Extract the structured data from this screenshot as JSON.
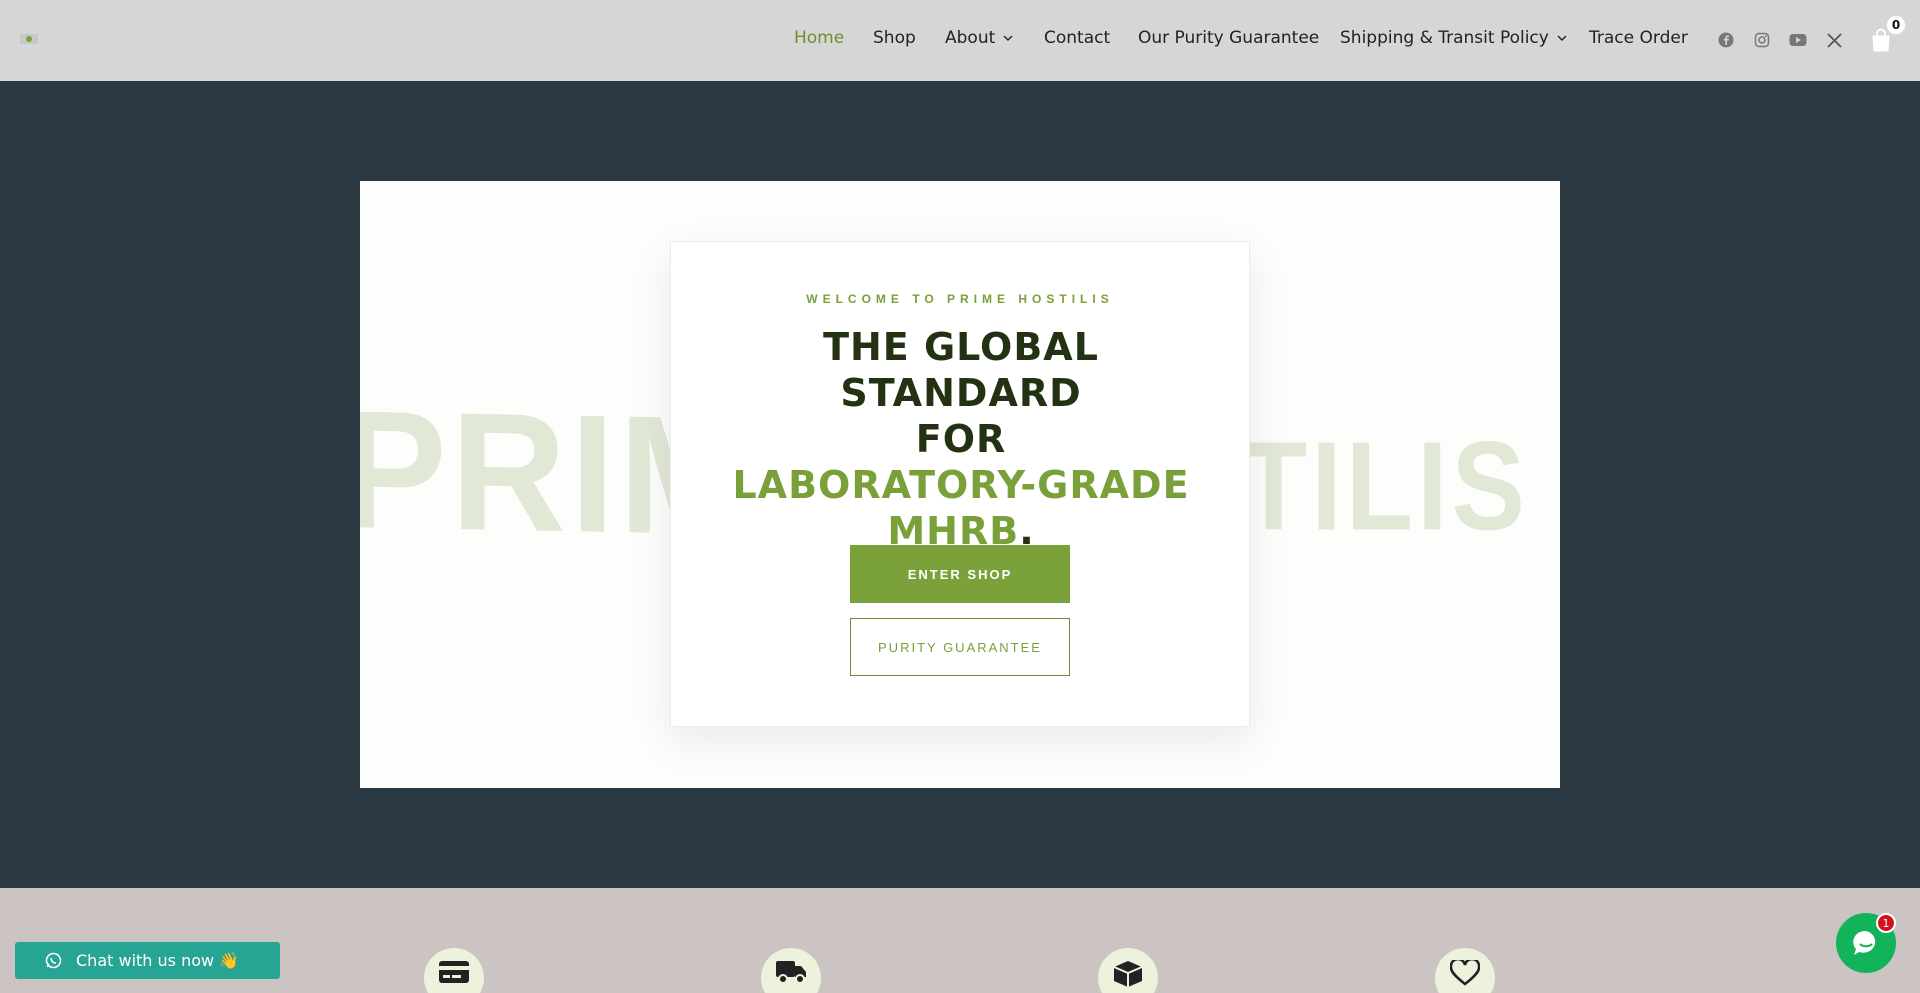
{
  "nav": {
    "items": [
      {
        "label": "Home",
        "active": true
      },
      {
        "label": "Shop"
      },
      {
        "label": "About",
        "dropdown": true
      },
      {
        "label": "Contact"
      },
      {
        "label": "Our Purity Guarantee"
      },
      {
        "label": "Shipping & Transit Policy",
        "dropdown": true
      },
      {
        "label": "Trace Order"
      }
    ],
    "social": [
      "facebook-icon",
      "instagram-icon",
      "youtube-icon",
      "x-icon"
    ],
    "cart_count": "0"
  },
  "hero": {
    "bg_left": "PRIM",
    "bg_right": "TILIS",
    "eyebrow": "WELCOME TO PRIME HOSTILIS",
    "headline_line1": "THE GLOBAL STANDARD",
    "headline_line2": "FOR",
    "headline_accent1": "LABORATORY-GRADE",
    "headline_accent2": "MHRB",
    "headline_period": ".",
    "primary_button": "ENTER SHOP",
    "secondary_button": "PURITY GUARANTEE"
  },
  "features": [
    "credit-card-icon",
    "truck-icon",
    "box-icon",
    "heart-icon"
  ],
  "chat": {
    "button_label": "Chat with us now 👋",
    "unread": "1"
  },
  "colors": {
    "accent": "#7ba23a",
    "header_bg": "#d6d6d6",
    "page_bg": "#293841",
    "chat_teal": "#27a594",
    "chat_green": "#13b35a"
  }
}
